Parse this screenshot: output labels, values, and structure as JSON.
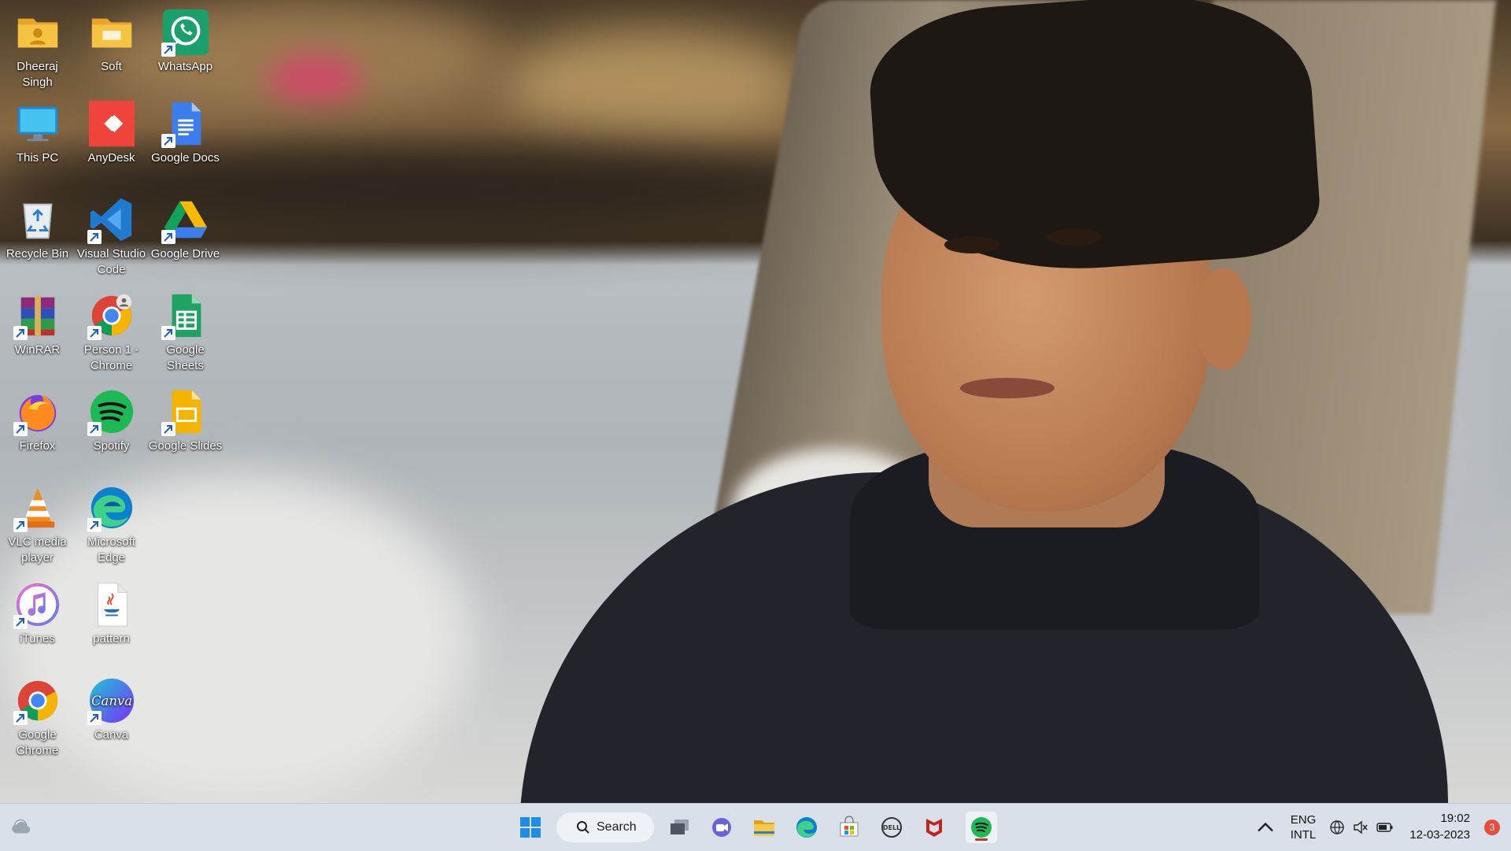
{
  "desktop": {
    "icons": [
      {
        "label": "Dheeraj Singh",
        "icon": "user-folder-icon"
      },
      {
        "label": "Soft",
        "icon": "folder-icon"
      },
      {
        "label": "WhatsApp",
        "icon": "whatsapp-icon"
      },
      {
        "label": "This PC",
        "icon": "monitor-icon"
      },
      {
        "label": "AnyDesk",
        "icon": "anydesk-icon"
      },
      {
        "label": "Google Docs",
        "icon": "google-docs-icon"
      },
      {
        "label": "Recycle Bin",
        "icon": "recycle-bin-icon"
      },
      {
        "label": "Visual Studio Code",
        "icon": "vscode-icon"
      },
      {
        "label": "Google Drive",
        "icon": "google-drive-icon"
      },
      {
        "label": "WinRAR",
        "icon": "winrar-icon"
      },
      {
        "label": "Person 1 - Chrome",
        "icon": "chrome-profile-icon"
      },
      {
        "label": "Google Sheets",
        "icon": "google-sheets-icon"
      },
      {
        "label": "Firefox",
        "icon": "firefox-icon"
      },
      {
        "label": "Spotify",
        "icon": "spotify-icon"
      },
      {
        "label": "Google Slides",
        "icon": "google-slides-icon"
      },
      {
        "label": "VLC media player",
        "icon": "vlc-icon"
      },
      {
        "label": "Microsoft Edge",
        "icon": "edge-icon"
      },
      {
        "label": "iTunes",
        "icon": "itunes-icon"
      },
      {
        "label": "pattern",
        "icon": "java-file-icon"
      },
      {
        "label": "Google Chrome",
        "icon": "chrome-icon"
      },
      {
        "label": "Canva",
        "icon": "canva-icon"
      }
    ]
  },
  "taskbar": {
    "search_label": "Search",
    "apps": [
      "start-icon",
      "task-view-icon",
      "teams-chat-icon",
      "file-explorer-icon",
      "edge-icon",
      "microsoft-store-icon",
      "dell-icon",
      "mcafee-icon",
      "spotify-icon"
    ],
    "active_app": "spotify-icon",
    "tray": {
      "language_line1": "ENG",
      "language_line2": "INTL",
      "time": "19:02",
      "date": "12-03-2023",
      "notification_count": "3"
    }
  },
  "colors": {
    "taskbar_bg": "#d9e0ea",
    "spotify_green": "#1db954",
    "active_indicator": "#c0392b"
  }
}
